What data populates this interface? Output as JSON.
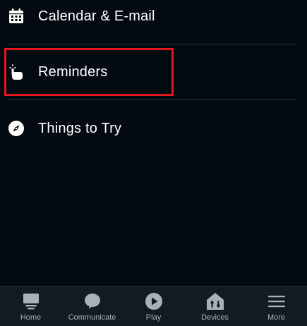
{
  "menu": {
    "items": [
      {
        "label": "Calendar & E-mail",
        "icon": "calendar-icon"
      },
      {
        "label": "Reminders",
        "icon": "reminder-hand-icon"
      },
      {
        "label": "Things to Try",
        "icon": "compass-icon"
      }
    ]
  },
  "highlight_color": "#e0181d",
  "bottom_nav": {
    "items": [
      {
        "label": "Home",
        "icon": "home-icon"
      },
      {
        "label": "Communicate",
        "icon": "chat-bubble-icon"
      },
      {
        "label": "Play",
        "icon": "play-icon"
      },
      {
        "label": "Devices",
        "icon": "devices-icon"
      },
      {
        "label": "More",
        "icon": "menu-icon"
      }
    ]
  }
}
